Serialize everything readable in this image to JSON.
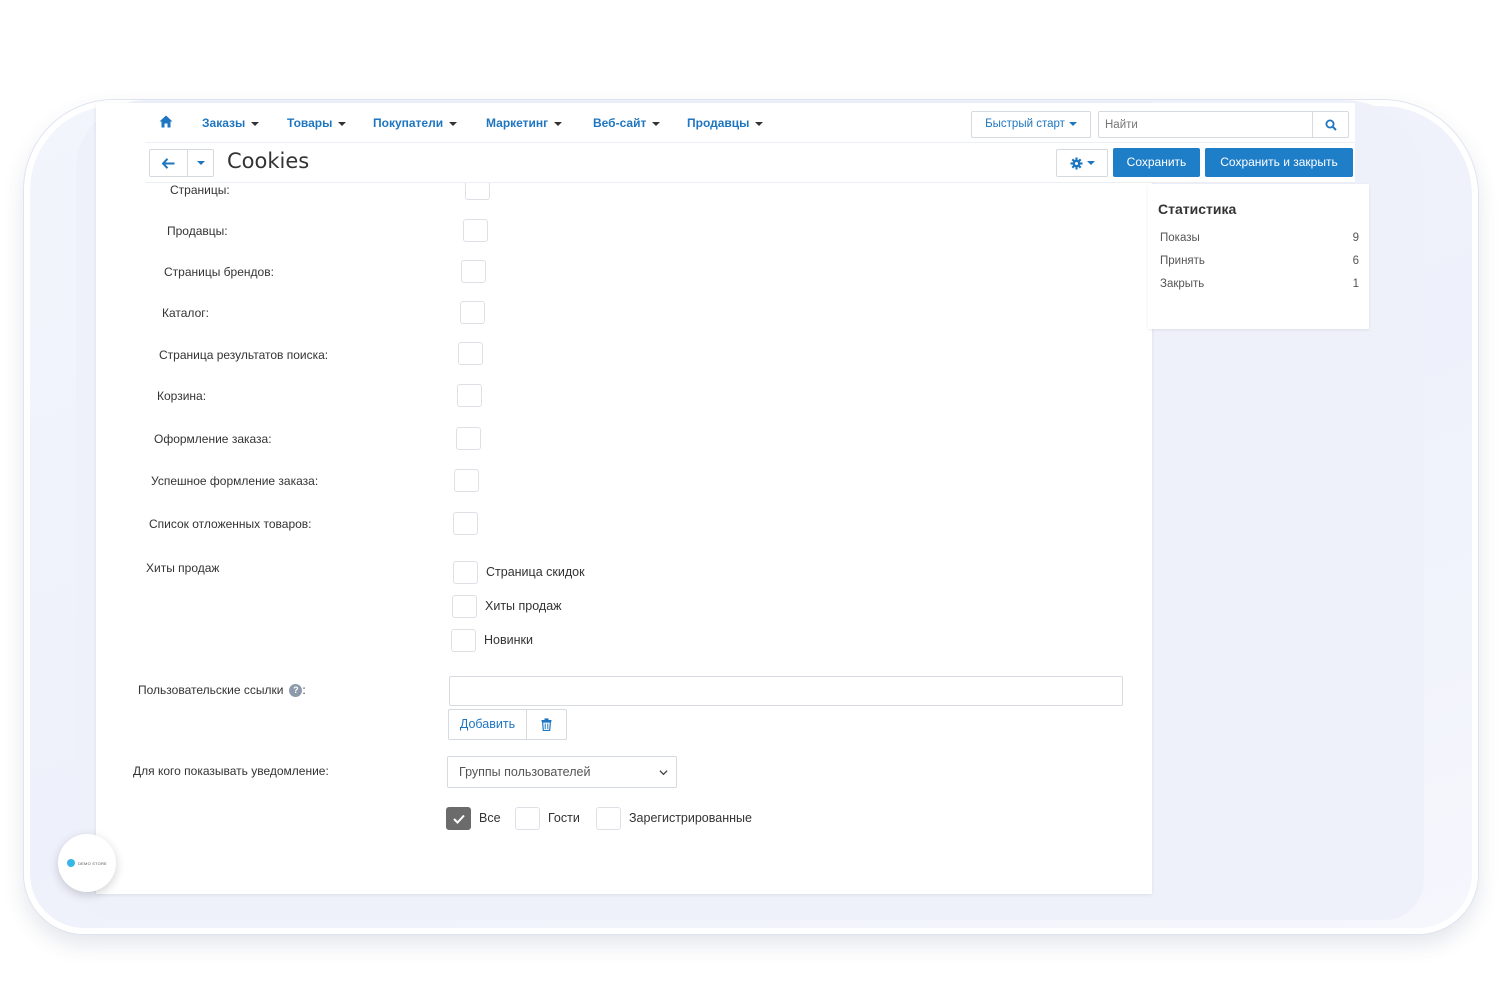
{
  "nav": {
    "items": [
      "Заказы",
      "Товары",
      "Покупатели",
      "Маркетинг",
      "Веб-сайт",
      "Продавцы"
    ],
    "quick_start": "Быстрый старт",
    "search_placeholder": "Найти"
  },
  "header": {
    "title": "Cookies",
    "save": "Сохранить",
    "save_close": "Сохранить и закрыть"
  },
  "form": {
    "pages": [
      {
        "label": "Страницы:",
        "checked": false
      },
      {
        "label": "Продавцы:",
        "checked": false
      },
      {
        "label": "Страницы брендов:",
        "checked": false
      },
      {
        "label": "Каталог:",
        "checked": false
      },
      {
        "label": "Страница результатов поиска:",
        "checked": false
      },
      {
        "label": "Корзина:",
        "checked": false
      },
      {
        "label": "Оформление заказа:",
        "checked": false
      },
      {
        "label": "Успешное формление заказа:",
        "checked": false
      },
      {
        "label": "Список отложенных товаров:",
        "checked": false
      }
    ],
    "bestsellers": {
      "label": "Хиты продаж",
      "options": [
        {
          "label": "Страница скидок",
          "checked": false
        },
        {
          "label": "Хиты продаж",
          "checked": false
        },
        {
          "label": "Новинки",
          "checked": false
        }
      ]
    },
    "custom_links": {
      "label": "Пользовательские ссылки",
      "suffix": ":",
      "value": "",
      "add": "Добавить"
    },
    "audience": {
      "label": "Для кого показывать уведомление:",
      "select_value": "Группы пользователей",
      "options": [
        {
          "label": "Все",
          "checked": true
        },
        {
          "label": "Гости",
          "checked": false
        },
        {
          "label": "Зарегистрированные",
          "checked": false
        }
      ]
    }
  },
  "stats": {
    "title": "Статистика",
    "rows": [
      {
        "label": "Показы",
        "value": "9"
      },
      {
        "label": "Принять",
        "value": "6"
      },
      {
        "label": "Закрыть",
        "value": "1"
      }
    ]
  },
  "badge": {
    "text": "DEMO STORE"
  },
  "colors": {
    "accent": "#1f7ec8",
    "link": "#1f76c0",
    "checked": "#6b6b6b"
  }
}
